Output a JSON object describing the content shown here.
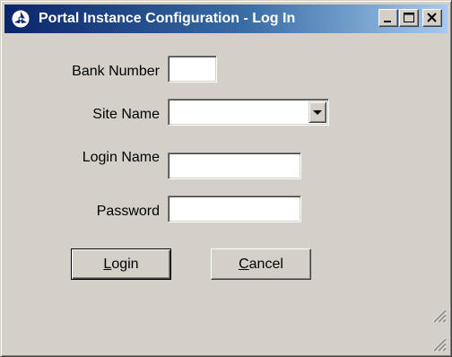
{
  "window": {
    "title": "Portal Instance Configuration - Log In",
    "icon": "app-logo-icon",
    "controls": {
      "minimize": "minimize-icon",
      "maximize": "maximize-icon",
      "close": "close-icon"
    }
  },
  "form": {
    "bank_number": {
      "label": "Bank Number",
      "value": ""
    },
    "site_name": {
      "label": "Site Name",
      "value": ""
    },
    "login_name": {
      "label": "Login Name",
      "value": ""
    },
    "password": {
      "label": "Password",
      "value": ""
    }
  },
  "buttons": {
    "login": {
      "label": "Login",
      "accel": "L",
      "rest": "ogin"
    },
    "cancel": {
      "label": "Cancel",
      "accel": "C",
      "rest": "ancel"
    }
  },
  "colors": {
    "title_gradient_start": "#0a246a",
    "title_gradient_end": "#a6caf0",
    "face": "#d4d0c8"
  }
}
